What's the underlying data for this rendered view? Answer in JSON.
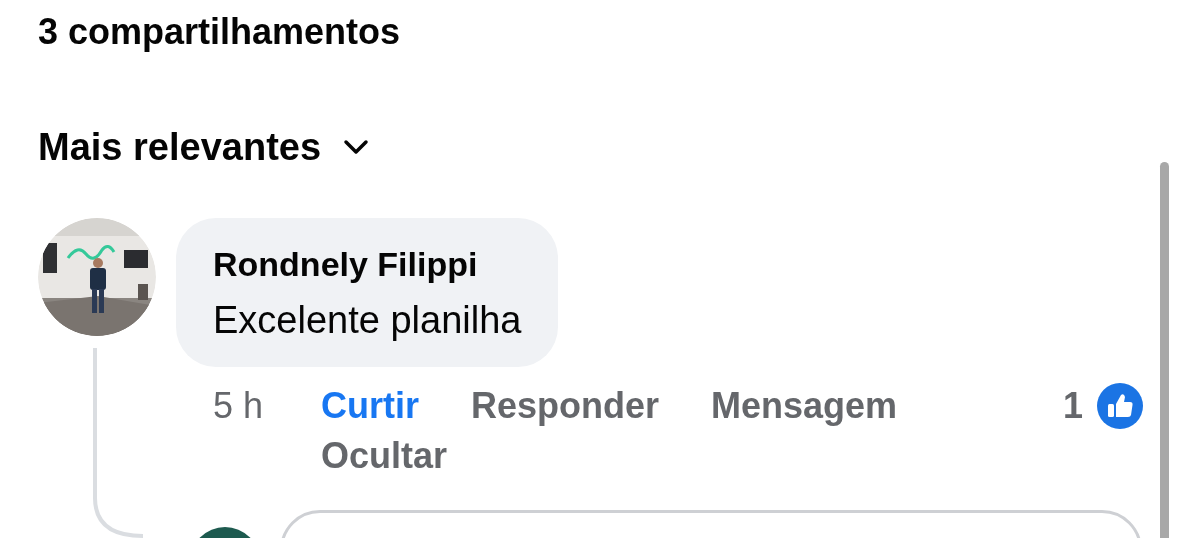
{
  "shares": "3 compartilhamentos",
  "sort": {
    "label": "Mais relevantes"
  },
  "comment": {
    "author": "Rondnely Filippi",
    "text": "Excelente planilha",
    "time": "5 h",
    "actions": [
      {
        "label": "Curtir",
        "selected": true
      },
      {
        "label": "Responder",
        "selected": false
      },
      {
        "label": "Mensagem",
        "selected": false
      },
      {
        "label": "Ocultar",
        "selected": false
      }
    ],
    "like_count": "1"
  }
}
